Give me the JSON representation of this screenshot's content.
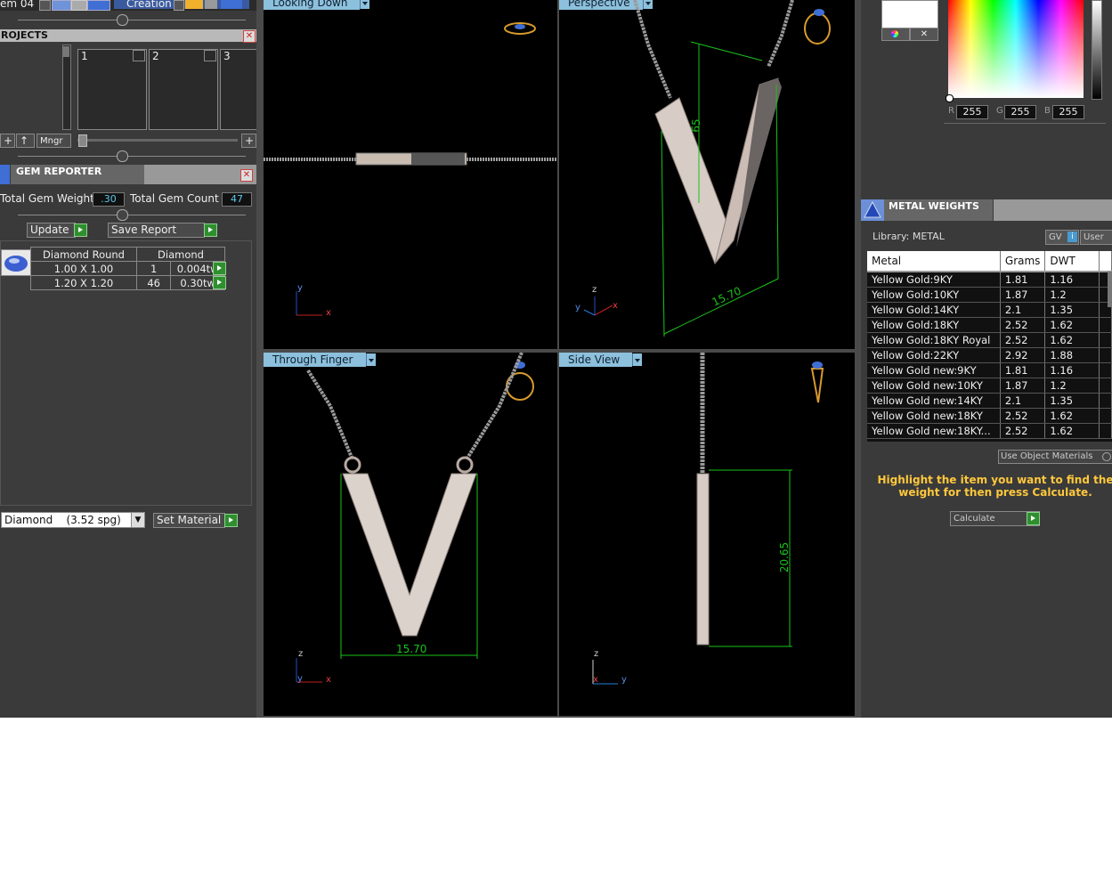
{
  "top_bar": {
    "left_label": "em 04",
    "creation_label": "Creation"
  },
  "projects": {
    "title": "ROJECTS",
    "slots": [
      "1",
      "2",
      "3"
    ],
    "mngr_label": "Mngr"
  },
  "gem_reporter": {
    "title": "GEM REPORTER",
    "total_weight_label": "Total Gem Weight",
    "total_weight_value": ".30",
    "total_count_label": "Total Gem Count",
    "total_count_value": "47",
    "update_label": "Update",
    "save_report_label": "Save Report",
    "table": {
      "headers": [
        "Diamond Round",
        "Diamond"
      ],
      "rows": [
        {
          "size": "1.00 X 1.00",
          "count": "1",
          "weight": "0.004tw"
        },
        {
          "size": "1.20 X 1.20",
          "count": "46",
          "weight": "0.30tw"
        }
      ]
    },
    "material_select": "Diamond    (3.52 spg)",
    "set_material_label": "Set Material"
  },
  "viewports": {
    "looking_down": {
      "label": "Looking Down",
      "axes": [
        "y",
        "x"
      ]
    },
    "perspective": {
      "label": "Perspective",
      "dim_a": "15.70",
      "dim_b": "65",
      "axes": [
        "z",
        "y",
        "x"
      ]
    },
    "through_finger": {
      "label": "Through Finger",
      "dim": "15.70",
      "axes": [
        "z",
        "y",
        "x"
      ]
    },
    "side_view": {
      "label": "Side View",
      "dim": "20.65",
      "axes": [
        "z",
        "x",
        "y"
      ]
    }
  },
  "color_picker": {
    "r_label": "R",
    "r_value": "255",
    "g_label": "G",
    "g_value": "255",
    "b_label": "B",
    "b_value": "255"
  },
  "metal_weights": {
    "title": "METAL WEIGHTS",
    "library_label": "Library: METAL",
    "gv_label": "GV",
    "user_label": "User",
    "columns": [
      "Metal",
      "Grams",
      "DWT"
    ],
    "rows": [
      {
        "metal": "Yellow Gold:9KY",
        "grams": "1.81",
        "dwt": "1.16"
      },
      {
        "metal": "Yellow Gold:10KY",
        "grams": "1.87",
        "dwt": "1.2"
      },
      {
        "metal": "Yellow Gold:14KY",
        "grams": "2.1",
        "dwt": "1.35"
      },
      {
        "metal": "Yellow Gold:18KY",
        "grams": "2.52",
        "dwt": "1.62"
      },
      {
        "metal": "Yellow Gold:18KY Royal",
        "grams": "2.52",
        "dwt": "1.62"
      },
      {
        "metal": "Yellow Gold:22KY",
        "grams": "2.92",
        "dwt": "1.88"
      },
      {
        "metal": "Yellow Gold new:9KY",
        "grams": "1.81",
        "dwt": "1.16"
      },
      {
        "metal": "Yellow Gold new:10KY",
        "grams": "1.87",
        "dwt": "1.2"
      },
      {
        "metal": "Yellow Gold new:14KY",
        "grams": "2.1",
        "dwt": "1.35"
      },
      {
        "metal": "Yellow Gold new:18KY",
        "grams": "2.52",
        "dwt": "1.62"
      },
      {
        "metal": "Yellow Gold new:18KY...",
        "grams": "2.52",
        "dwt": "1.62"
      }
    ],
    "use_object_materials_label": "Use Object Materials",
    "hint": "Highlight the item you want to find the weight for then press Calculate.",
    "calculate_label": "Calculate"
  },
  "colors": {
    "panel": "#3a3a3a",
    "viewport_tab": "#8cc0dc",
    "measure_green": "#19c319",
    "hint_yellow": "#ffc83c",
    "field_text": "#5ec8e8"
  }
}
